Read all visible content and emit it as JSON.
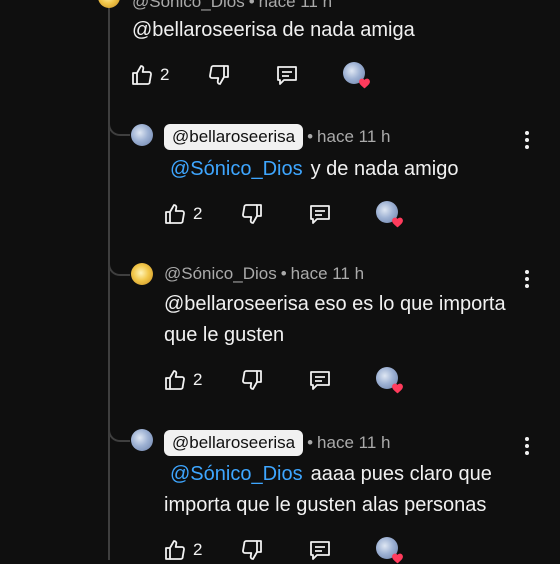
{
  "comments": [
    {
      "author": "@Sónico_Dios",
      "time": "hace 11 h",
      "mention": "",
      "text": "@bellaroseerisa de nada amiga",
      "likes": "2"
    },
    {
      "author": "@bellaroseerisa",
      "time": "hace 11 h",
      "mention": "@Sónico_Dios",
      "text": "y de nada amigo",
      "likes": "2"
    },
    {
      "author": "@Sónico_Dios",
      "time": "hace 11 h",
      "mention": "",
      "text": "@bellaroseerisa eso es lo que importa que le gusten",
      "likes": "2"
    },
    {
      "author": "@bellaroseerisa",
      "time": "hace 11 h",
      "mention": "@Sónico_Dios",
      "text": "aaaa pues claro que importa que le gusten alas personas",
      "likes": "2"
    }
  ],
  "separator": "•",
  "icons": {
    "like": "thumbs-up-icon",
    "dislike": "thumbs-down-icon",
    "reply": "reply-icon",
    "creator_heart": "creator-heart-icon",
    "more": "more-vert-icon"
  },
  "colors": {
    "background": "#0f0f0f",
    "text": "#f1f1f1",
    "muted": "#aaaaaa",
    "mention": "#3ea6ff",
    "heart": "#ff3b5c"
  }
}
